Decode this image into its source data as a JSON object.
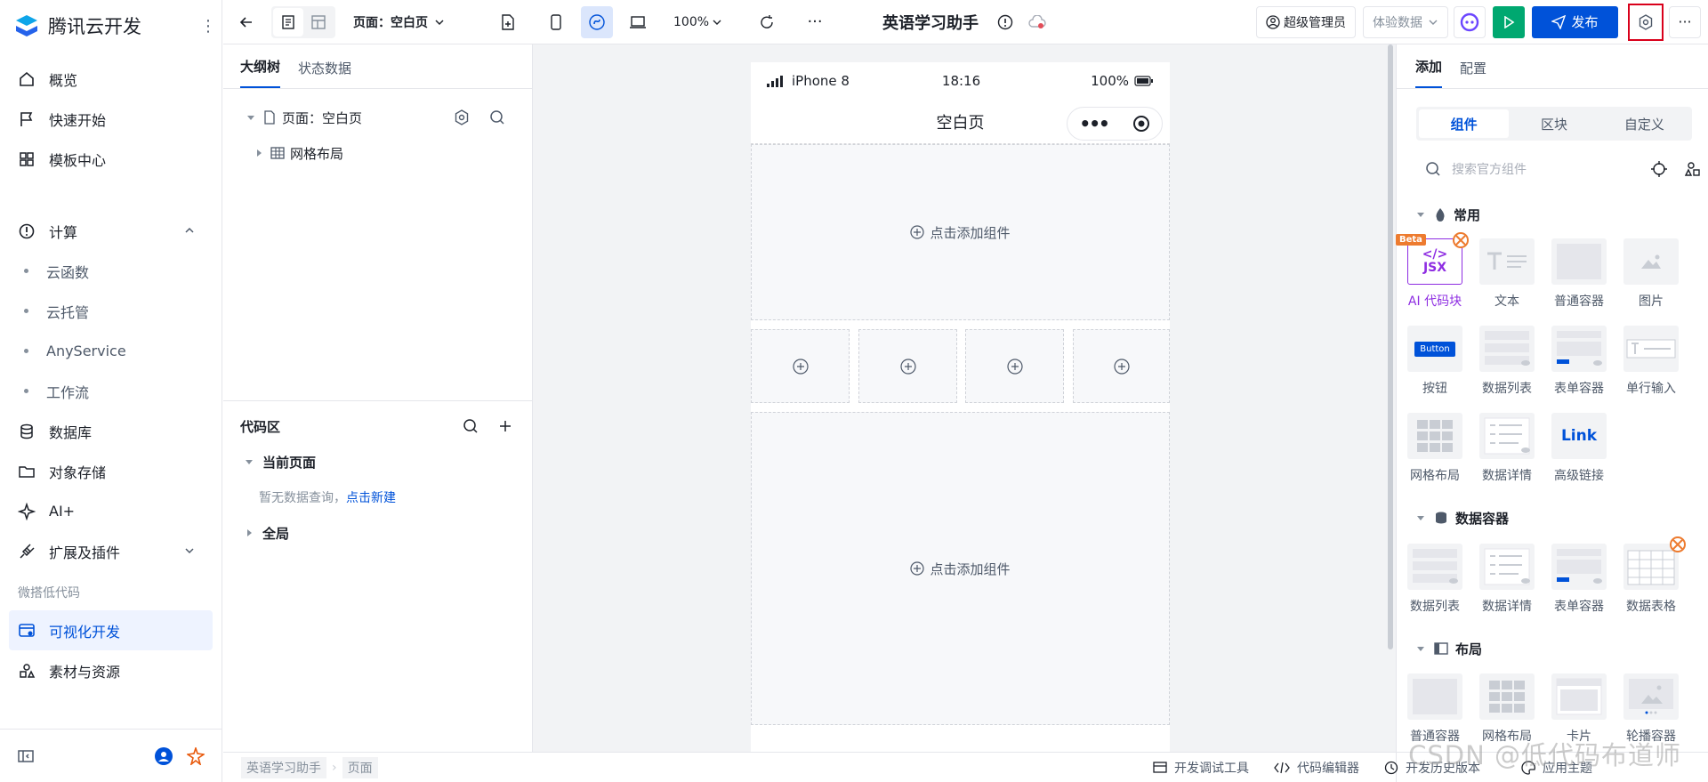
{
  "nav": {
    "brand": "腾讯云开发",
    "items": [
      {
        "label": "概览"
      },
      {
        "label": "快速开始"
      },
      {
        "label": "模板中心"
      },
      {
        "label": "计算"
      }
    ],
    "compute_sub": [
      "云函数",
      "云托管",
      "AnyService",
      "工作流"
    ],
    "items2": [
      {
        "label": "数据库"
      },
      {
        "label": "对象存储"
      },
      {
        "label": "AI+"
      },
      {
        "label": "扩展及插件"
      }
    ],
    "section": "微搭低代码",
    "active_item": "可视化开发",
    "last_item": "素材与资源"
  },
  "toolbar": {
    "page_selector": "页面：空白页",
    "zoom": "100%",
    "app_title": "英语学习助手",
    "role": "超级管理员",
    "data_mode": "体验数据",
    "publish": "发布"
  },
  "outline": {
    "tabs": [
      "大纲树",
      "状态数据"
    ],
    "page_node": "页面：空白页",
    "grid_node": "网格布局"
  },
  "code": {
    "title": "代码区",
    "current_page": "当前页面",
    "empty_text": "暂无数据查询，",
    "create_link": "点击新建",
    "global": "全局"
  },
  "phone": {
    "device": "iPhone 8",
    "time": "18:16",
    "battery": "100%",
    "page_title": "空白页",
    "add_component": "点击添加组件"
  },
  "right": {
    "tabs": [
      "添加",
      "配置"
    ],
    "segments": [
      "组件",
      "区块",
      "自定义"
    ],
    "search_placeholder": "搜索官方组件",
    "categories": {
      "common": "常用",
      "data": "数据容器",
      "layout": "布局"
    },
    "common": [
      "AI 代码块",
      "文本",
      "普通容器",
      "图片",
      "按钮",
      "数据列表",
      "表单容器",
      "单行输入",
      "网格布局",
      "数据详情",
      "高级链接"
    ],
    "data": [
      "数据列表",
      "数据详情",
      "表单容器",
      "数据表格"
    ],
    "layout": [
      "普通容器",
      "网格布局",
      "卡片",
      "轮播容器"
    ],
    "beta": "Beta",
    "jsx": "JSX",
    "button_thumb": "Button",
    "link_thumb": "Link"
  },
  "footer": {
    "crumbs": [
      "英语学习助手",
      "页面"
    ],
    "devtools": "开发调试工具",
    "code_editor": "代码编辑器",
    "history": "开发历史版本",
    "theme": "应用主题"
  },
  "watermark": "CSDN @低代码布道师",
  "colors": {
    "accent": "#0052d9",
    "green": "#00a870",
    "highlight": "#d9001b",
    "ai": "#8e2de2"
  }
}
